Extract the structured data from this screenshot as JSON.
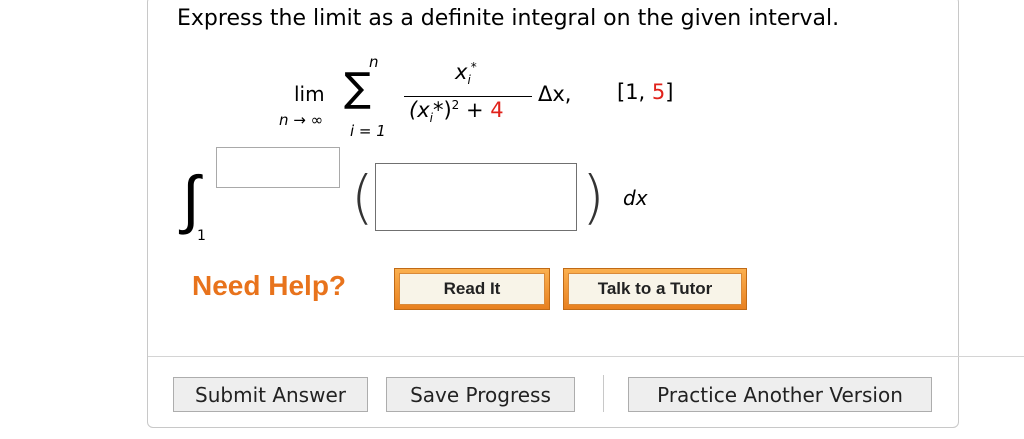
{
  "question": {
    "text": "Express the limit as a definite integral on the given interval."
  },
  "limit_expression": {
    "lim": "lim",
    "lim_sub": "n → ∞",
    "sigma": "∑",
    "sigma_upper": "n",
    "sigma_lower": "i = 1",
    "numerator_var": "x",
    "numerator_sub": "i",
    "numerator_sup": "*",
    "denominator_open": "(x",
    "denominator_sub": "i",
    "denominator_mid": "*)",
    "denominator_sup": "2",
    "denominator_plus": " + ",
    "denominator_const": "4",
    "delta": "Δx,",
    "interval_open": "[1, ",
    "interval_end": "5",
    "interval_close": "]"
  },
  "integral": {
    "symbol": "∫",
    "lower_limit": "1",
    "upper_limit_value": "",
    "integrand_value": "",
    "left_paren": "(",
    "right_paren": ")",
    "differential": "dx"
  },
  "help": {
    "need_help_label": "Need Help?",
    "read_it_label": "Read It",
    "talk_to_tutor_label": "Talk to a Tutor"
  },
  "actions": {
    "submit_label": "Submit Answer",
    "save_label": "Save Progress",
    "practice_label": "Practice Another Version"
  },
  "colors": {
    "accent_red": "#e0221b",
    "need_help_orange": "#e8731c",
    "help_button_orange": "#e8801f"
  }
}
